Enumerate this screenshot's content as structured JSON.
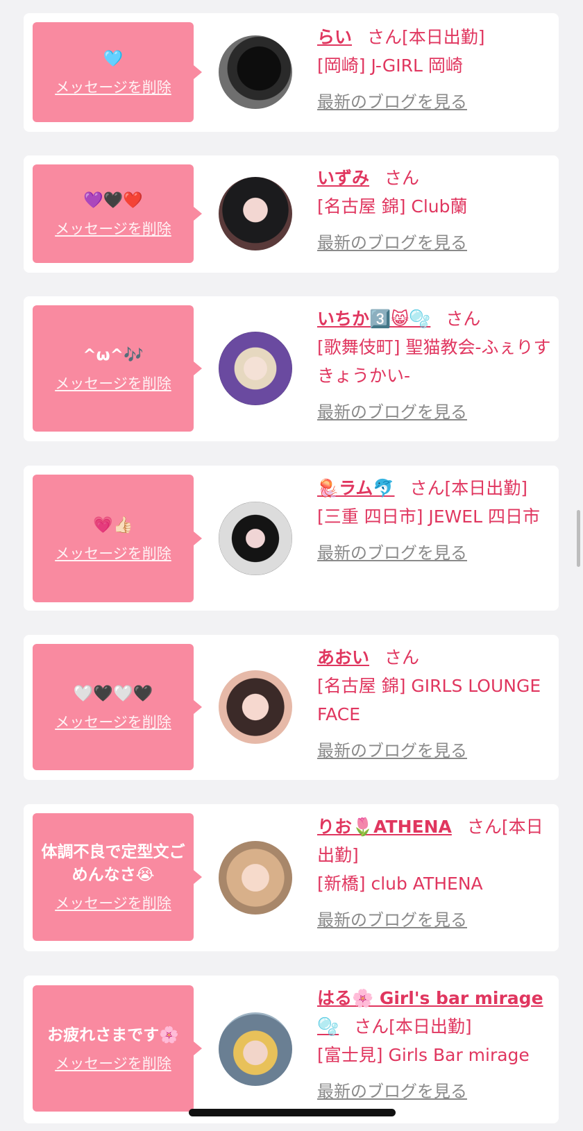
{
  "delete_label": "メッセージを削除",
  "blog_label": "最新のブログを見る",
  "colors": {
    "accent": "#e0365f",
    "message_bg": "#f98aa0",
    "page_bg": "#f2f2f4"
  },
  "cards": [
    {
      "message": "🩵",
      "name": "らい",
      "suffix": "さん[本日出勤]",
      "shop": "[岡崎] J-GIRL 岡崎"
    },
    {
      "message": "💜🖤❤️",
      "name": "いずみ",
      "suffix": "さん",
      "shop": "[名古屋 錦] Club蘭"
    },
    {
      "message": "^ω^🎶",
      "name": "いちか3️⃣😸🫧",
      "suffix": "さん",
      "shop": "[歌舞伎町] 聖猫教会-ふぇりすきょうかい-"
    },
    {
      "message": "💗👍🏻",
      "name": "🪼ラム🐬",
      "suffix": "さん[本日出勤]",
      "shop": "[三重 四日市] JEWEL 四日市"
    },
    {
      "message": "🤍🖤🤍🖤",
      "name": "あおい",
      "suffix": "さん",
      "shop": "[名古屋 錦] GIRLS LOUNGE FACE"
    },
    {
      "message": "体調不良で定型文ごめんなさ😭",
      "name": "りお🌷ATHENA",
      "suffix": "さん[本日出勤]",
      "shop": "[新橋] club ATHENA"
    },
    {
      "message": "お疲れさまです🌸",
      "name": "はる🌸 Girl's bar mirage 🫧",
      "suffix": "さん[本日出勤]",
      "shop": "[富士見] Girls Bar mirage"
    }
  ]
}
